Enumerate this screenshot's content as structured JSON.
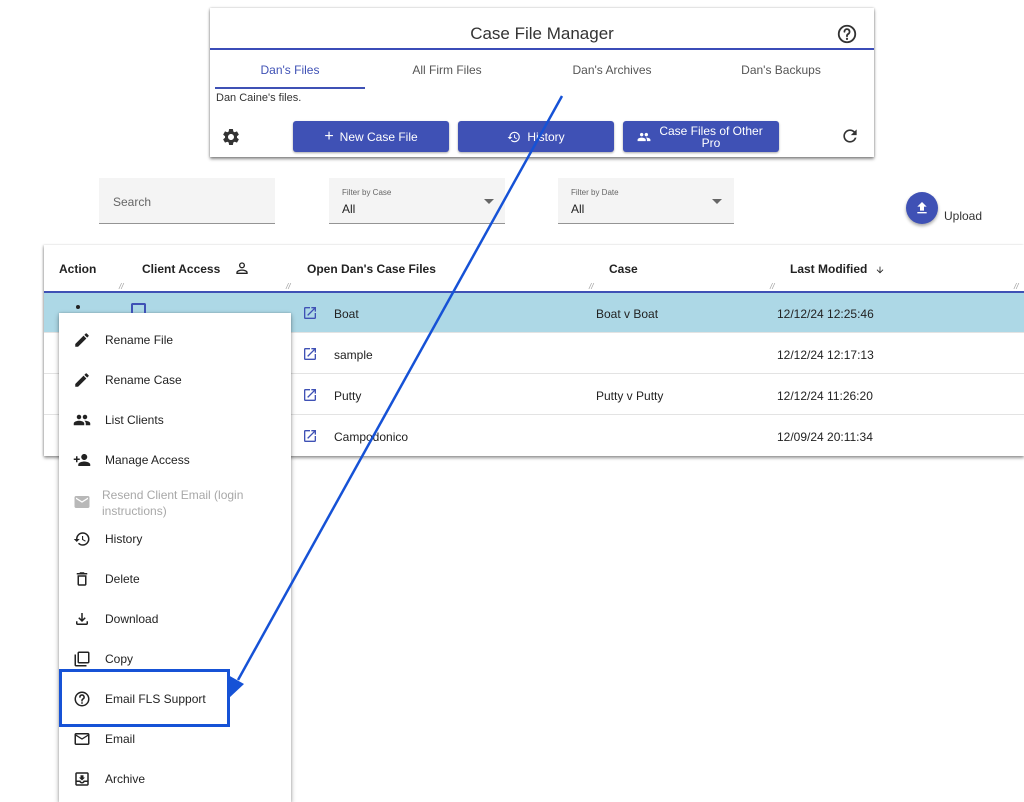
{
  "app": {
    "title": "Case File Manager",
    "subtitle": "Dan Caine's files."
  },
  "tabs": [
    {
      "label": "Dan's Files",
      "active": true
    },
    {
      "label": "All Firm Files",
      "active": false
    },
    {
      "label": "Dan's Archives",
      "active": false
    },
    {
      "label": "Dan's Backups",
      "active": false
    }
  ],
  "toolbar": {
    "new_case_label": "New Case File",
    "history_label": "History",
    "other_pro_label": "Case Files of Other Pro"
  },
  "filters": {
    "search_placeholder": "Search",
    "case_label": "Filter by Case",
    "case_value": "All",
    "date_label": "Filter by Date",
    "date_value": "All",
    "upload_label": "Upload"
  },
  "table": {
    "headers": {
      "action": "Action",
      "client_access": "Client Access",
      "open": "Open Dan's Case Files",
      "case": "Case",
      "last_modified": "Last Modified"
    },
    "rows": [
      {
        "name": "Boat",
        "case": "Boat v Boat",
        "modified": "12/12/24 12:25:46",
        "selected": true
      },
      {
        "name": "sample",
        "case": "",
        "modified": "12/12/24 12:17:13",
        "selected": false
      },
      {
        "name": "Putty",
        "case": "Putty v Putty",
        "modified": "12/12/24 11:26:20",
        "selected": false
      },
      {
        "name": "Campodonico",
        "case": "",
        "modified": "12/09/24 20:11:34",
        "selected": false
      }
    ]
  },
  "menu": {
    "items": [
      {
        "label": "Rename File",
        "icon": "pencil-icon",
        "disabled": false
      },
      {
        "label": "Rename Case",
        "icon": "pencil-icon",
        "disabled": false
      },
      {
        "label": "List Clients",
        "icon": "people-icon",
        "disabled": false
      },
      {
        "label": "Manage Access",
        "icon": "person-add-icon",
        "disabled": false
      },
      {
        "label": "Resend Client Email (login instructions)",
        "icon": "mail-icon",
        "disabled": true
      },
      {
        "label": "History",
        "icon": "history-icon",
        "disabled": false
      },
      {
        "label": "Delete",
        "icon": "trash-icon",
        "disabled": false
      },
      {
        "label": "Download",
        "icon": "download-icon",
        "disabled": false
      },
      {
        "label": "Copy",
        "icon": "copy-icon",
        "disabled": false
      },
      {
        "label": "Email FLS Support",
        "icon": "help-icon",
        "disabled": false,
        "highlighted": true
      },
      {
        "label": "Email",
        "icon": "mail-outline-icon",
        "disabled": false
      },
      {
        "label": "Archive",
        "icon": "archive-icon",
        "disabled": false
      }
    ]
  },
  "colors": {
    "primary": "#3f51b5",
    "selected_row": "#add8e6",
    "annotation": "#1652d6"
  }
}
